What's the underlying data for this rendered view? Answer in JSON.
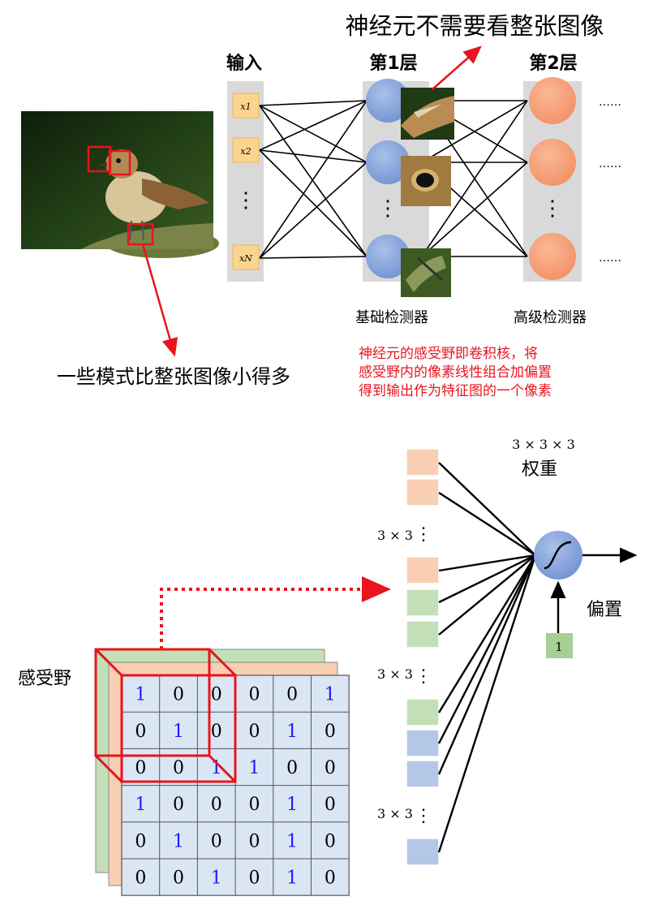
{
  "top": {
    "title": "神经元不需要看整张图像",
    "input_label": "输入",
    "layer1_label": "第1层",
    "layer2_label": "第2层",
    "input_nodes": [
      "x1",
      "x2",
      "xN"
    ],
    "vdots": "⋮",
    "hdots": "……",
    "basic_detector_label": "基础检测器",
    "advanced_detector_label": "高级检测器",
    "pattern_note": "一些模式比整张图像小得多",
    "rf_note": [
      "神经元的感受野即卷积核，将",
      "感受野内的像素线性组合加偏置",
      "得到输出作为特征图的一个像素"
    ],
    "colors": {
      "input_node": "#fbd58f",
      "layer1_node": "#8aa7dc",
      "layer2_node": "#f7a47f",
      "column_bg": "#d9d9d9",
      "red": "#e8141e"
    }
  },
  "bottom": {
    "weights_label": "权重",
    "weights_dim": "3 × 3 × 3",
    "block_dim": "3 × 3",
    "bias_label": "偏置",
    "bias_value": "1",
    "receptive_field_label": "感受野",
    "matrix": [
      [
        "1",
        "0",
        "0",
        "0",
        "0",
        "1"
      ],
      [
        "0",
        "1",
        "0",
        "0",
        "1",
        "0"
      ],
      [
        "0",
        "0",
        "1",
        "1",
        "0",
        "0"
      ],
      [
        "1",
        "0",
        "0",
        "0",
        "1",
        "0"
      ],
      [
        "0",
        "1",
        "0",
        "0",
        "1",
        "0"
      ],
      [
        "0",
        "0",
        "1",
        "0",
        "1",
        "0"
      ]
    ],
    "colors": {
      "weight_orange": "#f9cfb3",
      "weight_green": "#c3dfb8",
      "weight_blue": "#b5c7e6",
      "matrix_bg": "#dbe6f4",
      "highlight_one": "#1a1aff",
      "neuron": "#8aa7dc",
      "bias_box": "#a5cf94"
    }
  }
}
